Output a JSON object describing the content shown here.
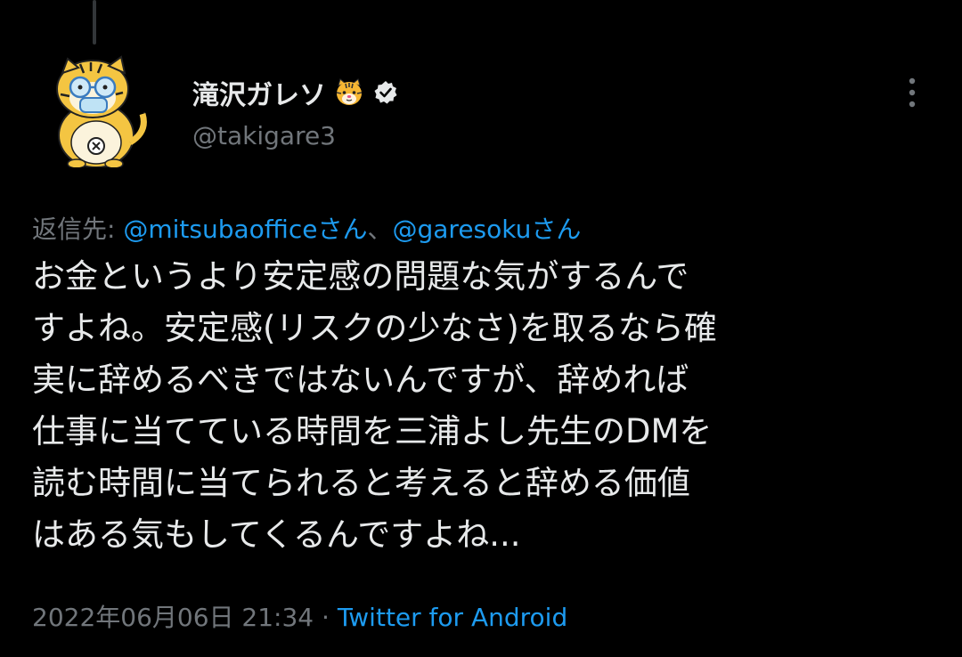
{
  "tweet": {
    "author": {
      "display_name": "滝沢ガレソ",
      "handle": "@takigare3",
      "avatar_icon": "tiger-mascot-avatar",
      "name_emoji_icon": "tiger-face-emoji",
      "verified_icon": "verified-badge-icon"
    },
    "more_icon": "more-options-icon",
    "reply": {
      "prefix": "返信先: ",
      "mentions": [
        "@mitsubaofficeさん",
        "@garesokuさん"
      ],
      "separator": "、"
    },
    "body_lines": [
      "お金というより安定感の問題な気がするんで",
      "すよね。安定感(リスクの少なさ)を取るなら確",
      "実に辞めるべきではないんですが、辞めれば",
      "仕事に当てている時間を三浦よし先生のDMを",
      "読む時間に当てられると考えると辞める価値",
      "はある気もしてくるんですよね..."
    ],
    "timestamp": "2022年06月06日 21:34",
    "separator": " · ",
    "source": "Twitter for Android"
  },
  "colors": {
    "background": "#000000",
    "text_primary": "#e7e9ea",
    "text_secondary": "#71767b",
    "link": "#1d9bf0",
    "thread_line": "#333639"
  }
}
